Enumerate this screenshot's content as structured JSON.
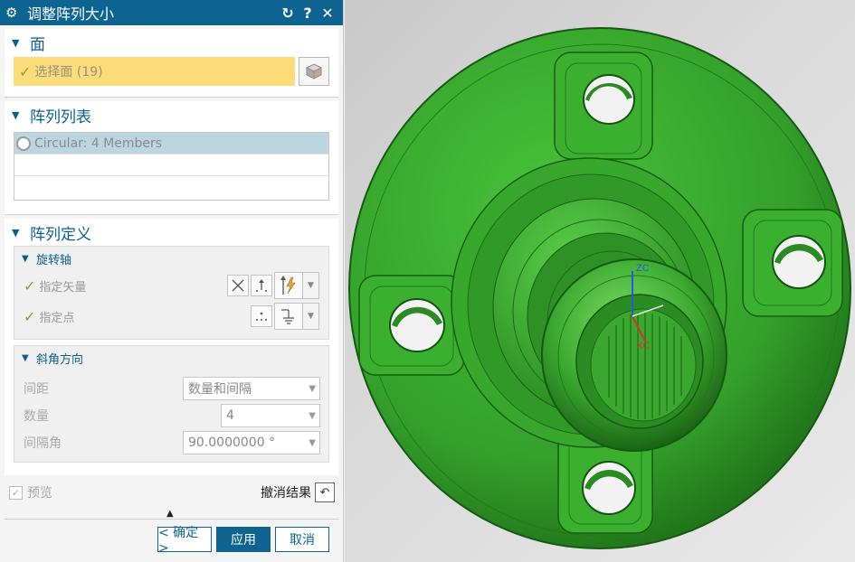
{
  "dialog": {
    "title": "调整阵列大小",
    "icons": {
      "settings": "gear-icon",
      "reset": "reset-icon",
      "help": "help-icon",
      "close": "close-icon"
    },
    "title_help": "?",
    "title_close": "✕",
    "title_reset": "↻"
  },
  "face_group": {
    "title": "面",
    "select_label": "选择面 (19)"
  },
  "pattern_list": {
    "title": "阵列列表",
    "rows": [
      "Circular: 4 Members",
      "",
      ""
    ]
  },
  "pattern_def": {
    "title": "阵列定义",
    "rotation_axis": {
      "title": "旋转轴",
      "specify_vector": "指定矢量",
      "specify_point": "指定点"
    },
    "bevel_direction": {
      "title": "斜角方向",
      "spacing_label": "间距",
      "spacing_value": "数量和间隔",
      "count_label": "数量",
      "count_value": "4",
      "pitch_label": "间隔角",
      "pitch_value": "90.0000000 °"
    }
  },
  "preview": {
    "label": "预览",
    "checked": true
  },
  "undo_result": {
    "label": "撤消结果"
  },
  "buttons": {
    "ok": "< 确定 >",
    "apply": "应用",
    "cancel": "取消"
  },
  "viewport": {
    "part_color": "#35a42b",
    "axis_labels": {
      "z": "ZC",
      "x": "XC"
    }
  },
  "colors": {
    "title_bar": "#0e6491",
    "selection_highlight": "#fcdc78",
    "list_selected": "#bcd6e1",
    "accent": "#0b5f8f"
  }
}
